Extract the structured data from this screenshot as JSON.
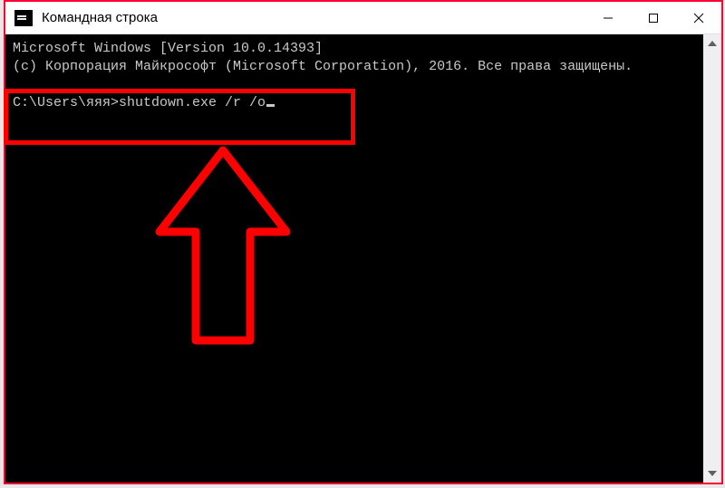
{
  "window": {
    "title": "Командная строка"
  },
  "console": {
    "line1": "Microsoft Windows [Version 10.0.14393]",
    "line2": "(c) Корпорация Майкрософт (Microsoft Corporation), 2016. Все права защищены.",
    "prompt": "C:\\Users\\яяя>",
    "command": "shutdown.exe /r /o"
  },
  "icons": {
    "minimize": "minimize-icon",
    "maximize": "maximize-icon",
    "close": "close-icon",
    "scroll_up": "chevron-up-icon",
    "scroll_down": "chevron-down-icon",
    "app": "cmd-icon"
  },
  "annotation": {
    "color": "#ff0000"
  }
}
